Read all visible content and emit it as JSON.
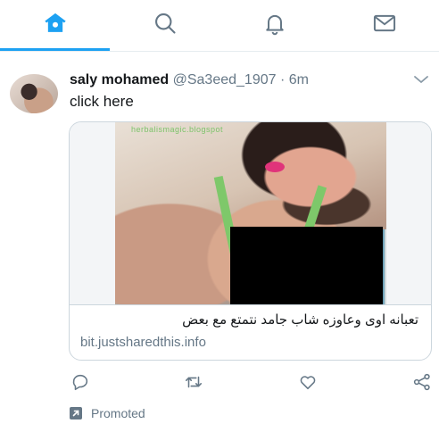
{
  "nav": {
    "tabs": [
      {
        "name": "home",
        "icon": "home-icon",
        "active": true
      },
      {
        "name": "search",
        "icon": "search-icon",
        "active": false
      },
      {
        "name": "notifications",
        "icon": "bell-icon",
        "active": false
      },
      {
        "name": "messages",
        "icon": "envelope-icon",
        "active": false
      }
    ],
    "active_color": "#1da1f2",
    "inactive_color": "#657786"
  },
  "tweet": {
    "display_name": "saly mohamed",
    "handle": "@Sa3eed_1907",
    "separator": "·",
    "time": "6m",
    "text": "click here",
    "menu_icon": "chevron-down-icon"
  },
  "card": {
    "image_watermark": "herbalismagic.blogspot",
    "title": "تعبانه اوى وعاوزه شاب جامد نتمتع مع بعض",
    "domain": "bit.justsharedthis.info"
  },
  "actions": [
    {
      "name": "reply",
      "icon": "reply-icon"
    },
    {
      "name": "retweet",
      "icon": "retweet-icon"
    },
    {
      "name": "like",
      "icon": "heart-icon"
    },
    {
      "name": "share",
      "icon": "share-icon"
    }
  ],
  "promoted": {
    "label": "Promoted",
    "icon": "promoted-icon"
  }
}
